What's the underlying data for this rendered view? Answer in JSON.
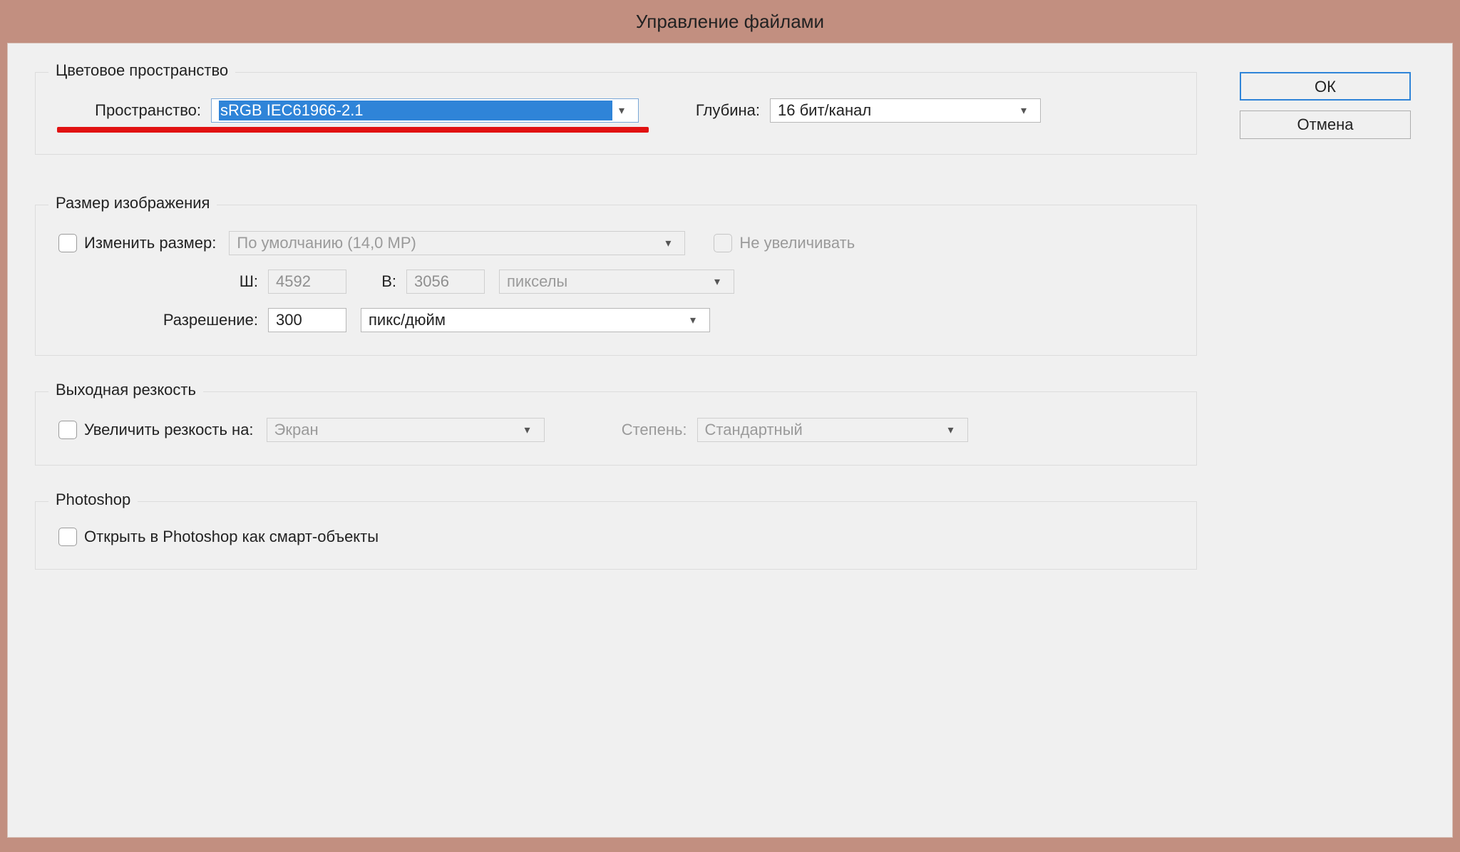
{
  "window": {
    "title": "Управление файлами"
  },
  "buttons": {
    "ok": "ОК",
    "cancel": "Отмена"
  },
  "colorspace": {
    "legend": "Цветовое пространство",
    "space_label": "Пространство:",
    "space_value": "sRGB IEC61966-2.1",
    "depth_label": "Глубина:",
    "depth_value": "16 бит/канал"
  },
  "imagesize": {
    "legend": "Размер изображения",
    "resize_cb_label": "Изменить размер:",
    "resize_preset": "По умолчанию (14,0 MP)",
    "no_enlarge_label": "Не увеличивать",
    "w_label": "Ш:",
    "w_value": "4592",
    "h_label": "В:",
    "h_value": "3056",
    "unit_value": "пикселы",
    "res_label": "Разрешение:",
    "res_value": "300",
    "res_unit": "пикс/дюйм"
  },
  "sharpen": {
    "legend": "Выходная резкость",
    "cb_label": "Увеличить резкость на:",
    "target_value": "Экран",
    "amount_label": "Степень:",
    "amount_value": "Стандартный"
  },
  "photoshop": {
    "legend": "Photoshop",
    "smart_label": "Открыть в Photoshop как смарт-объекты"
  }
}
